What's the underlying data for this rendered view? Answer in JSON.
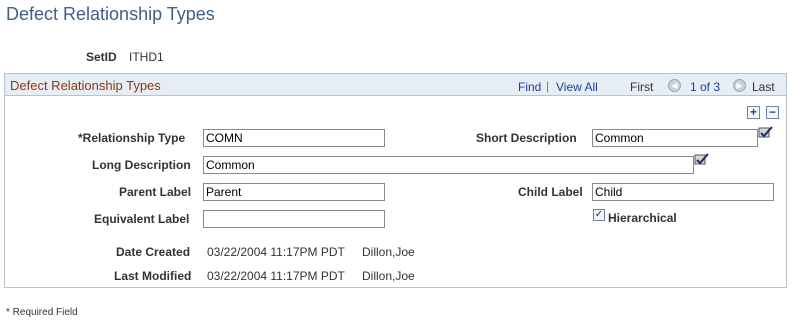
{
  "page": {
    "title": "Defect Relationship Types"
  },
  "setid": {
    "label": "SetID",
    "value": "ITHD1"
  },
  "grid": {
    "title": "Defect Relationship Types",
    "find_label": "Find",
    "view_all_label": "View All",
    "first_label": "First",
    "pager_text": "1 of 3",
    "last_label": "Last",
    "prev_icon": "arrow-left-circle-icon",
    "next_icon": "arrow-right-circle-icon",
    "add_row_label": "+",
    "delete_row_label": "−"
  },
  "form": {
    "relationship_type": {
      "label": "*Relationship Type",
      "value": "COMN"
    },
    "short_description": {
      "label": "Short Description",
      "value": "Common"
    },
    "long_description": {
      "label": "Long Description",
      "value": "Common"
    },
    "parent_label": {
      "label": "Parent Label",
      "value": "Parent"
    },
    "child_label": {
      "label": "Child Label",
      "value": "Child"
    },
    "equivalent_label": {
      "label": "Equivalent Label",
      "value": ""
    },
    "hierarchical": {
      "label": "Hierarchical",
      "checked": true,
      "check_mark": "✓"
    },
    "date_created": {
      "label": "Date Created",
      "value": "03/22/2004 11:17PM PDT",
      "user": "Dillon,Joe"
    },
    "last_modified": {
      "label": "Last Modified",
      "value": "03/22/2004 11:17PM PDT",
      "user": "Dillon,Joe"
    }
  },
  "icons": {
    "spell_check": "spell-check-icon"
  },
  "footer": {
    "required_note": "* Required Field"
  },
  "colors": {
    "title": "#3f5f85",
    "grid_title": "#8b3a0f",
    "link": "#1f3f9a",
    "header_bg": "#e6edf4",
    "border": "#b7c3cf"
  }
}
